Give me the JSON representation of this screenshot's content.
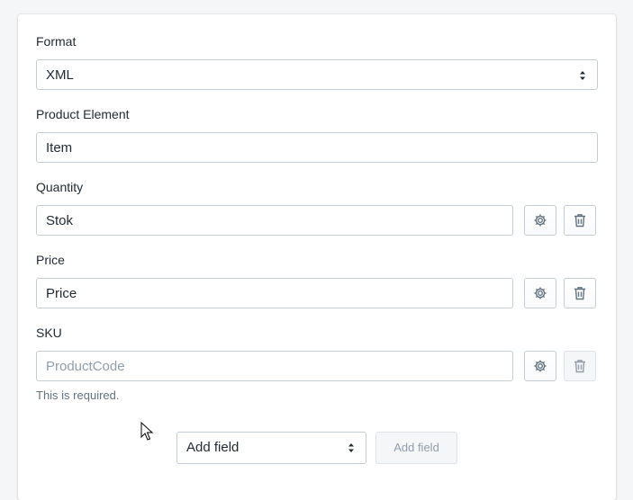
{
  "form": {
    "format": {
      "label": "Format",
      "value": "XML"
    },
    "product_element": {
      "label": "Product Element",
      "value": "Item"
    },
    "fields": [
      {
        "label": "Quantity",
        "value": "Stok",
        "placeholder": ""
      },
      {
        "label": "Price",
        "value": "Price",
        "placeholder": ""
      },
      {
        "label": "SKU",
        "value": "",
        "placeholder": "ProductCode",
        "error": "This is required."
      }
    ],
    "add_field": {
      "select_value": "Add field",
      "button_label": "Add field"
    }
  },
  "icons": {
    "settings": "gear-icon",
    "delete": "trash-icon",
    "select": "select-arrows-icon"
  },
  "colors": {
    "border": "#c4cdd5",
    "text": "#212b36",
    "muted": "#637381",
    "placeholder": "#919eab"
  }
}
